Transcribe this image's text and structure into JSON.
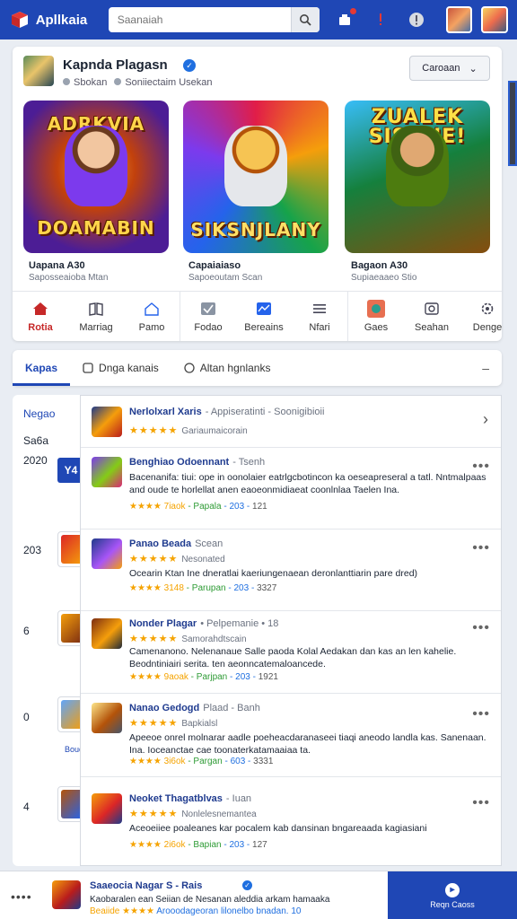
{
  "header": {
    "app_name": "Apllkaia",
    "search_placeholder": "Saanaiah"
  },
  "developer": {
    "name": "Kapnda Plagasn",
    "meta": [
      "Sbokan",
      "Soniiectaim Usekan"
    ],
    "follow_label": "Caroaan"
  },
  "games": [
    {
      "art_top": "ADRKVIA",
      "art_bottom": "DOAMABIN",
      "label": "Uapana A30",
      "sub": "Saposseaioba Mtan"
    },
    {
      "art_top": "",
      "art_bottom": "SIKSNJLANY",
      "label": "Capaiaiaso",
      "sub": "Sapoeoutam Scan"
    },
    {
      "art_top": "ZUALEK SISDNE!",
      "art_bottom": "",
      "label": "Bagaon A30",
      "sub": "Supiaeaaeo Stio"
    }
  ],
  "categories": [
    [
      {
        "label": "Rotia",
        "icon": "home-icon",
        "active": true
      },
      {
        "label": "Marriag",
        "icon": "book-icon"
      },
      {
        "label": "Pamo",
        "icon": "house-icon"
      }
    ],
    [
      {
        "label": "Fodao",
        "icon": "check-icon"
      },
      {
        "label": "Bereains",
        "icon": "chart-icon"
      },
      {
        "label": "Nfari",
        "icon": "menu-icon"
      }
    ],
    [
      {
        "label": "Gaes",
        "icon": "game-icon"
      },
      {
        "label": "Seahan",
        "icon": "photo-icon"
      },
      {
        "label": "Denge",
        "icon": "settings-icon"
      }
    ]
  ],
  "tabs": [
    {
      "label": "Kapas",
      "active": true
    },
    {
      "label": "Dnga kanais",
      "icon": "square-icon"
    },
    {
      "label": "Altan hgnlanks",
      "icon": "circle-icon"
    }
  ],
  "tabs_collapse": "–",
  "left_rail": {
    "labels": [
      "Negao",
      "Sa6a",
      "2020"
    ],
    "blue_button": "Y4",
    "numbers": [
      "203",
      "6",
      "0",
      "4"
    ],
    "sub_label": "Bouc"
  },
  "feed": [
    {
      "title": "Nerlolxarl Xaris",
      "title_rest": "- Appiseratinti - Soonigibioii",
      "stars": "★★★★★",
      "stars_note": "Gariaumaicorain",
      "has_chevron": true
    },
    {
      "title": "Benghiao Odoennant",
      "title_rest": "- Tsenh",
      "desc": "Bacenanifa: tiui: ope in oonolaier eatrlgcbotincon ka oeseapreseral a tatl. Nntmalpaas and oude te horlellat anen eaoeonmidiaeat coonlnlaa Taelen Ina.",
      "meta": "★★★★ 7iaok",
      "meta_g": "- Papala",
      "meta_b": "- 203 -",
      "meta_n": "121"
    },
    {
      "title": "Panao Beada",
      "title_rest": "Scean",
      "stars": "★★★★★",
      "stars_note": "Nesonated",
      "desc": "Ocearin Ktan Ine dneratlai kaeriungenaean deronlanttiarin pare dred)",
      "meta": "★★★★ 3148",
      "meta_g": "- Parupan",
      "meta_b": "- 203 -",
      "meta_n": "3327"
    },
    {
      "title": "Nonder Plagar",
      "title_rest": "• Pelpemanie • 18",
      "stars": "★★★★★",
      "stars_note": "Samorahdtscain",
      "desc": "Camenanono. Nelenanaue Salle paoda Kolal Aedakan dan kas an len kahelie. Beodntiniairi serita. ten aeonncatemaloancede.",
      "meta": "★★★★ 9aoak",
      "meta_g": "- Parjpan",
      "meta_b": "- 203 -",
      "meta_n": "1921"
    },
    {
      "title": "Nanao Gedogd",
      "title_rest": "Plaad - Banh",
      "stars": "★★★★★",
      "stars_note": "Bapkialsl",
      "desc": "Apeeoe onrel molnarar aadle poeheacdaranaseei tiaqi aneodo landla kas. Sanenaan. Ina. Ioceanctae cae toonaterkatamaaiaa ta.",
      "meta": "★★★★ 3i6ok",
      "meta_g": "- Pargan",
      "meta_b": "- 603 -",
      "meta_n": "3331"
    },
    {
      "title": "Neoket Thagatblvas",
      "title_rest": "- Iuan",
      "stars": "★★★★★",
      "stars_note": "Nonlelesnemantea",
      "desc": "Aceoeiiee poaleanes kar pocalem kab dansinan bngareaada kagiasiani",
      "meta": "★★★★ 2i6ok",
      "meta_g": "- Bapian",
      "meta_b": "- 203 -",
      "meta_n": "127"
    }
  ],
  "bottom_bar": {
    "title": "Saaeocia Nagar S - Rais",
    "line": "Kaobaralen ean Seiian de Nesanan aleddia arkam hamaaka",
    "stars_label": "Beaiide ★★★★",
    "stars_rest": "Arooodageoran lilonelbo bnadan. 10",
    "button_label": "Reqn Caoss"
  },
  "colors": {
    "brand_blue": "#1f47b5",
    "star": "#f5a300",
    "active_red": "#c62828"
  }
}
